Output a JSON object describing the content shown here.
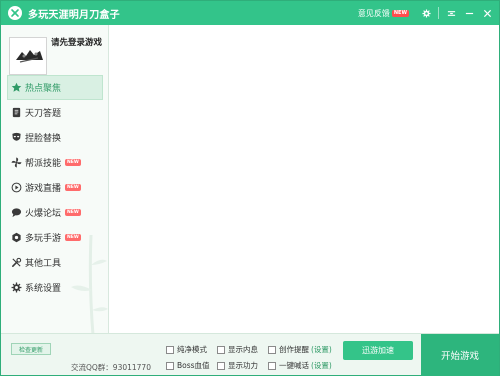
{
  "window": {
    "title": "多玩天涯明月刀盒子",
    "feedback_label": "意见反馈",
    "new_badge": "NEW"
  },
  "colors": {
    "accent": "#33c48a",
    "accent_dark": "#2db57d",
    "badge": "#ff4d4d"
  },
  "profile": {
    "login_prompt": "请先登录游戏"
  },
  "sidebar": {
    "items": [
      {
        "label": "热点聚焦",
        "icon": "star-icon",
        "active": true,
        "badge": ""
      },
      {
        "label": "天刀答题",
        "icon": "notebook-icon",
        "active": false,
        "badge": ""
      },
      {
        "label": "捏脸替换",
        "icon": "mask-icon",
        "active": false,
        "badge": ""
      },
      {
        "label": "帮派技能",
        "icon": "pinwheel-icon",
        "active": false,
        "badge": "NEW"
      },
      {
        "label": "游戏直播",
        "icon": "play-icon",
        "active": false,
        "badge": "NEW"
      },
      {
        "label": "火爆论坛",
        "icon": "chat-bubble-icon",
        "active": false,
        "badge": "NEW"
      },
      {
        "label": "多玩手游",
        "icon": "hexagon-icon",
        "active": false,
        "badge": "NEW"
      },
      {
        "label": "其他工具",
        "icon": "tools-icon",
        "active": false,
        "badge": ""
      },
      {
        "label": "系统设置",
        "icon": "gear-icon",
        "active": false,
        "badge": ""
      }
    ]
  },
  "bottom": {
    "check_update": "检查更新",
    "qq_group": "交流QQ群：93011770",
    "options": {
      "pure_mode": "纯净模式",
      "show_content": "显示内息",
      "creation_reminder": "创作提醒",
      "boss_hp": "Boss血值",
      "show_power": "显示功力",
      "one_key_revive": "一键喊话",
      "settings_link": "(设置)"
    },
    "speed_button": "迅游加速",
    "start_button": "开始游戏"
  }
}
